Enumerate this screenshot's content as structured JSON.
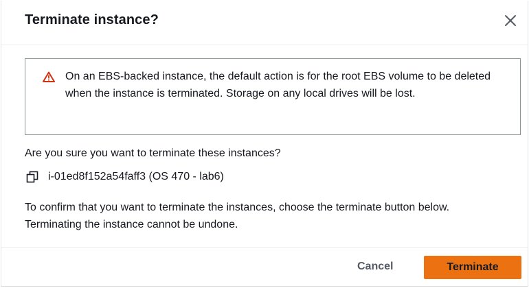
{
  "dialog": {
    "title": "Terminate instance?",
    "close_icon": "close-icon"
  },
  "warning": {
    "icon": "warning-triangle-icon",
    "icon_color": "#d13212",
    "text": "On an EBS-backed instance, the default action is for the root EBS volume to be deleted when the instance is terminated. Storage on any local drives will be lost."
  },
  "body": {
    "question": "Are you sure you want to terminate these instances?",
    "instance": {
      "icon": "copy-icon",
      "label": "i-01ed8f152a54faff3 (OS 470 - lab6)"
    },
    "confirm_text": "To confirm that you want to terminate the instances, choose the terminate button below. Terminating the instance cannot be undone."
  },
  "footer": {
    "cancel_label": "Cancel",
    "terminate_label": "Terminate",
    "primary_color": "#ec7211"
  }
}
